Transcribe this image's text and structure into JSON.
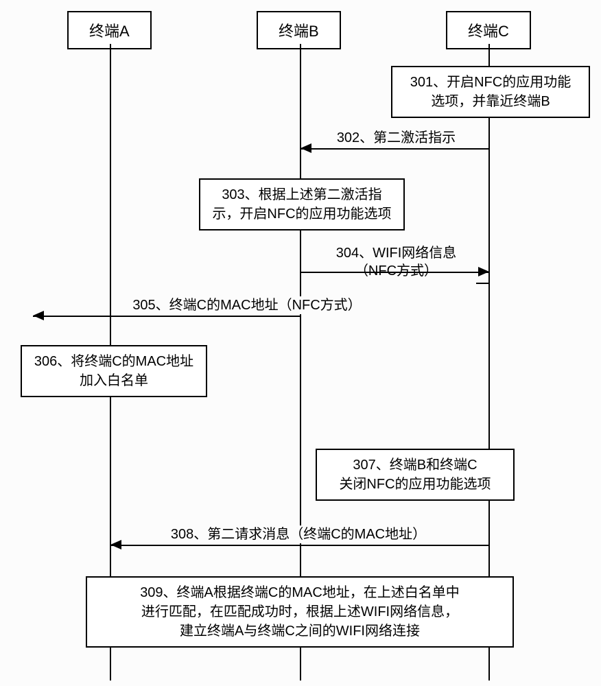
{
  "participants": {
    "p1": "终端A",
    "p2": "终端B",
    "p3": "终端C"
  },
  "steps": {
    "s301_l1": "301、开启NFC的应用功能",
    "s301_l2": "选项，并靠近终端B",
    "s302": "302、第二激活指示",
    "s303_l1": "303、根据上述第二激活指",
    "s303_l2": "示，开启NFC的应用功能选项",
    "s304_l1": "304、WIFI网络信息",
    "s304_l2": "（NFC方式）",
    "s305": "305、终端C的MAC地址（NFC方式）",
    "s306_l1": "306、将终端C的MAC地址",
    "s306_l2": "加入白名单",
    "s307_l1": "307、终端B和终端C",
    "s307_l2": "关闭NFC的应用功能选项",
    "s308": "308、第二请求消息（终端C的MAC地址）",
    "s309_l1": "309、终端A根据终端C的MAC地址，在上述白名单中",
    "s309_l2": "进行匹配，在匹配成功时，根据上述WIFI网络信息，",
    "s309_l3": "建立终端A与终端C之间的WIFI网络连接"
  }
}
